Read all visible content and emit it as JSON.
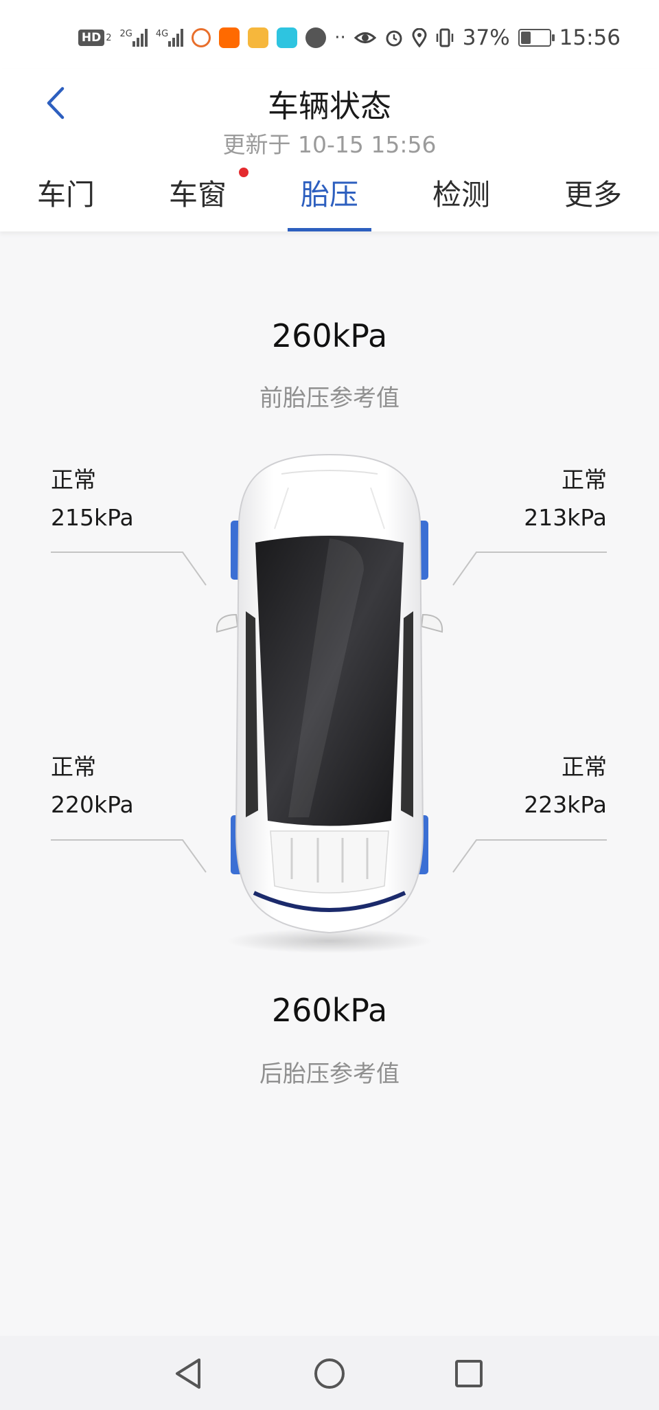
{
  "status_bar": {
    "hd_label": "HD",
    "sim_index": "2",
    "net1": "2G",
    "net2": "4G",
    "battery_percent": "37%",
    "battery_level": 0.37,
    "time": "15:56",
    "icons": [
      "hd-icon",
      "signal-2g-icon",
      "signal-4g-icon",
      "app-icon-weibo",
      "app-icon-taobao",
      "app-icon-bank",
      "app-icon-bulb",
      "app-icon-navigation",
      "more-dots-icon",
      "eye-icon",
      "alarm-icon",
      "location-icon",
      "vibrate-icon",
      "battery-icon"
    ]
  },
  "header": {
    "title": "车辆状态",
    "subtitle": "更新于 10-15 15:56",
    "back_icon": "chevron-left-icon"
  },
  "tabs": [
    {
      "label": "车门",
      "active": false,
      "badge": false
    },
    {
      "label": "车窗",
      "active": false,
      "badge": true
    },
    {
      "label": "胎压",
      "active": true,
      "badge": false
    },
    {
      "label": "检测",
      "active": false,
      "badge": false
    },
    {
      "label": "更多",
      "active": false,
      "badge": false
    }
  ],
  "tire_pressure": {
    "front_reference": {
      "value": "260kPa",
      "label": "前胎压参考值"
    },
    "rear_reference": {
      "value": "260kPa",
      "label": "后胎压参考值"
    },
    "front_left": {
      "status": "正常",
      "pressure": "215kPa"
    },
    "front_right": {
      "status": "正常",
      "pressure": "213kPa"
    },
    "rear_left": {
      "status": "正常",
      "pressure": "220kPa"
    },
    "rear_right": {
      "status": "正常",
      "pressure": "223kPa"
    }
  },
  "colors": {
    "accent": "#2d5fbf",
    "badge": "#e42a2e",
    "secondary_text": "#9b9b9b",
    "tyre_highlight": "#3b6fd4"
  },
  "nav_bar": {
    "back": "triangle-back-icon",
    "home": "circle-home-icon",
    "recents": "square-recents-icon"
  }
}
